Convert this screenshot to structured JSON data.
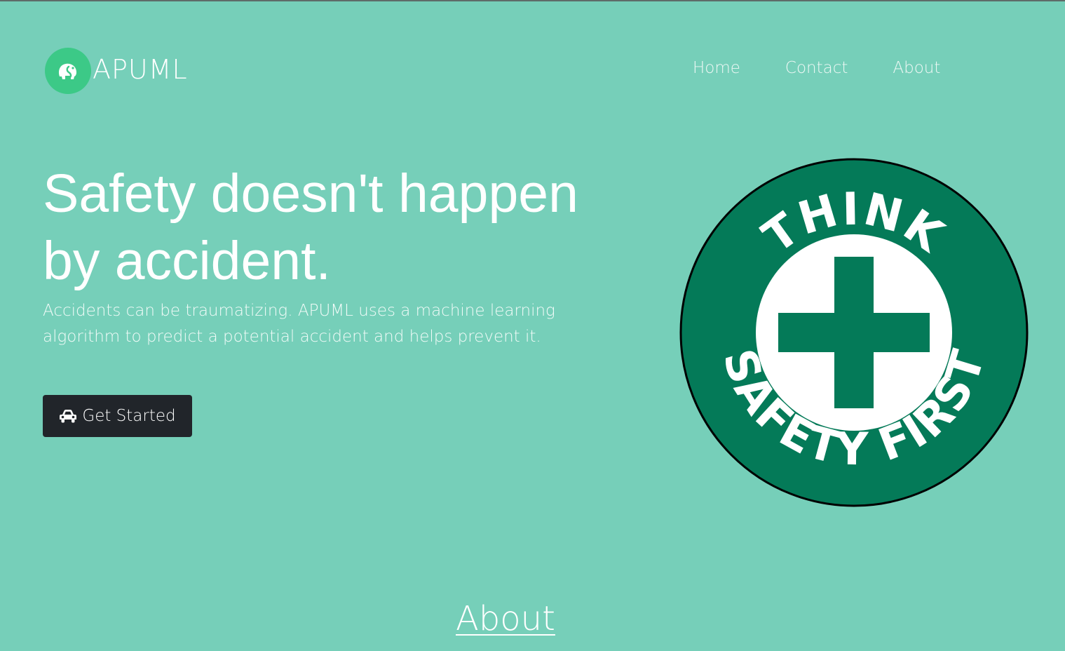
{
  "brand": {
    "name": "APUML",
    "logo_icon": "elephant-icon",
    "logo_color": "#3cc987"
  },
  "nav": {
    "items": [
      {
        "label": "Home"
      },
      {
        "label": "Contact"
      },
      {
        "label": "About"
      }
    ]
  },
  "hero": {
    "headline": "Safety doesn't happen by accident.",
    "lead": "Accidents can be traumatizing. APUML uses a machine learning algorithm to predict a potential accident and helps prevent it.",
    "cta_label": "Get Started",
    "cta_icon": "car-icon"
  },
  "badge": {
    "top_text": "THINK",
    "bottom_text": "SAFETY FIRST",
    "ring_color": "#047a58",
    "icon": "cross-icon"
  },
  "about": {
    "title": "About"
  },
  "colors": {
    "background": "#76cfb9",
    "button": "#21252a",
    "text": "#ffffff"
  }
}
